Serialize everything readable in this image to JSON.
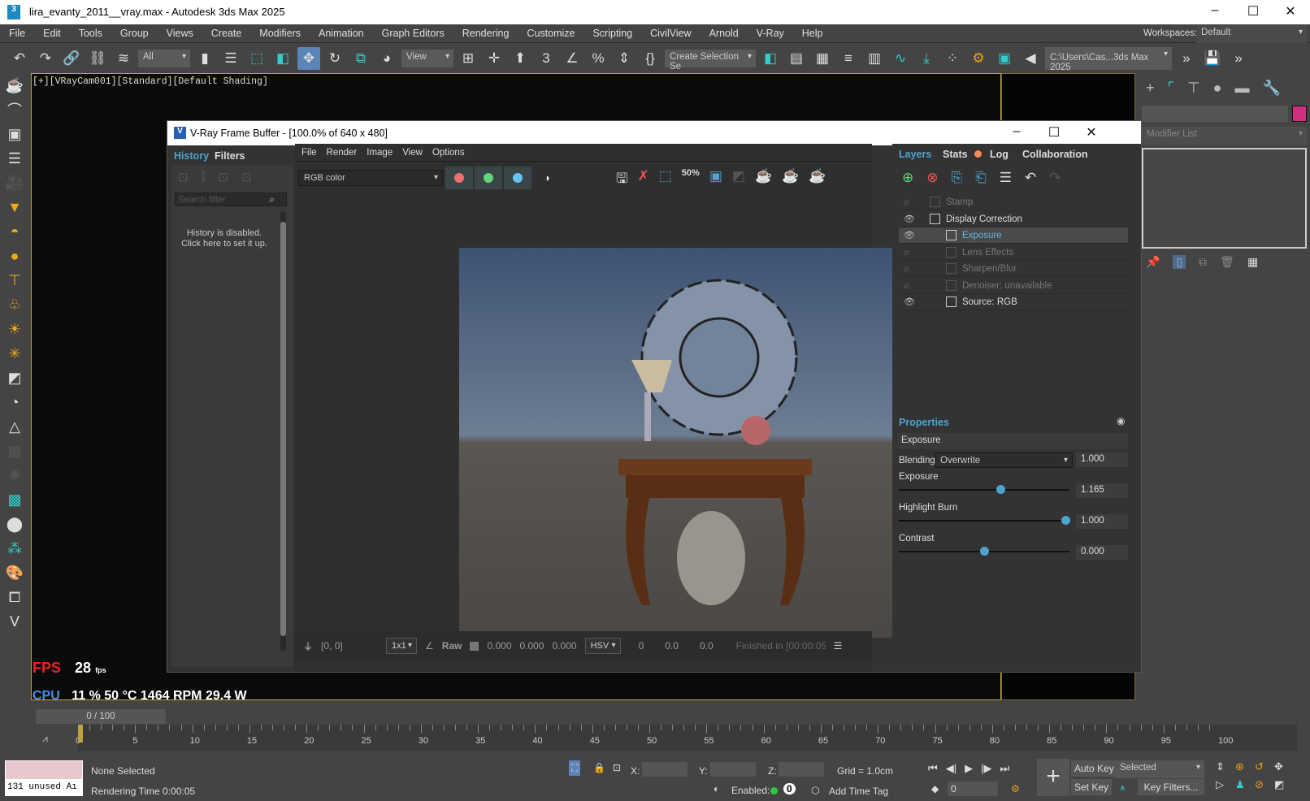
{
  "window": {
    "title": "lira_evanty_2011__vray.max - Autodesk 3ds Max 2025",
    "icon": "3dsmax-icon"
  },
  "menu": [
    "File",
    "Edit",
    "Tools",
    "Group",
    "Views",
    "Create",
    "Modifiers",
    "Animation",
    "Graph Editors",
    "Rendering",
    "Customize",
    "Scripting",
    "CivilView",
    "Arnold",
    "V-Ray",
    "Help"
  ],
  "workspaces": {
    "label": "Workspaces:",
    "value": "Default"
  },
  "toolbar": {
    "filter": "All",
    "ref_coord": "View",
    "selection_set": "Create Selection Se",
    "project_path": "C:\\Users\\Cas...3ds Max 2025"
  },
  "viewport": {
    "label": "[+][VRayCam001][Standard][Default Shading]",
    "fps_label": "FPS",
    "fps_value": "28",
    "fps_unit": "fps",
    "cpu_label": "CPU",
    "cpu_stats": "11 % 50 °C 1464 RPM 29.4 W"
  },
  "command_panel": {
    "modifier_list": "Modifier List",
    "object_color": "#d1307f"
  },
  "vfb": {
    "title": "V-Ray Frame Buffer - [100.0% of 640 x 480]",
    "left_tabs": [
      "History",
      "Filters"
    ],
    "search_placeholder": "Search filter",
    "history_msg1": "History is disabled.",
    "history_msg2": "Click here to set it up.",
    "menu": [
      "File",
      "Render",
      "Image",
      "View",
      "Options"
    ],
    "channel": "RGB color",
    "zoom_btn": "50%",
    "bottom": {
      "coords": "[0, 0]",
      "sample": "1x1",
      "raw": "Raw",
      "r": "0.000",
      "g": "0.000",
      "b": "0.000",
      "mode": "HSV",
      "h": "0",
      "s": "0.0",
      "v": "0.0",
      "status": "Finished in [00:00:05.0"
    },
    "right_tabs": [
      "Layers",
      "Stats",
      "Log",
      "Collaboration"
    ],
    "layers": [
      {
        "name": "Stamp",
        "visible": false,
        "indent": 0
      },
      {
        "name": "Display Correction",
        "visible": true,
        "indent": 0
      },
      {
        "name": "Exposure",
        "visible": true,
        "indent": 1,
        "selected": true
      },
      {
        "name": "Lens Effects",
        "visible": false,
        "indent": 1
      },
      {
        "name": "Sharpen/Blur",
        "visible": false,
        "indent": 1
      },
      {
        "name": "Denoiser: unavailable",
        "visible": false,
        "indent": 1
      },
      {
        "name": "Source: RGB",
        "visible": true,
        "indent": 1
      }
    ],
    "properties": {
      "title": "Properties",
      "layer": "Exposure",
      "blending_label": "Blending",
      "blending": "Overwrite",
      "blending_value": "1.000",
      "exposure_label": "Exposure",
      "exposure": "1.165",
      "exposure_pos": 0.6,
      "burn_label": "Highlight Burn",
      "burn": "1.000",
      "burn_pos": 1.0,
      "contrast_label": "Contrast",
      "contrast": "0.000",
      "contrast_pos": 0.5
    }
  },
  "timeline": {
    "frame": "0 / 100",
    "ticks": [
      "0",
      "5",
      "10",
      "15",
      "20",
      "25",
      "30",
      "35",
      "40",
      "45",
      "50",
      "55",
      "60",
      "65",
      "70",
      "75",
      "80",
      "85",
      "90",
      "95",
      "100"
    ]
  },
  "status": {
    "script_out": "131 unused Aı",
    "selection": "None Selected",
    "render_time": "Rendering Time  0:00:05",
    "x": "X:",
    "y": "Y:",
    "z": "Z:",
    "grid": "Grid = 1.0cm",
    "enabled": "Enabled:",
    "enabled_count": "0",
    "add_time_tag": "Add Time Tag",
    "auto_key": "Auto Key",
    "set_key": "Set Key",
    "key_mode": "Selected",
    "key_filters": "Key Filters...",
    "frame": "0"
  }
}
